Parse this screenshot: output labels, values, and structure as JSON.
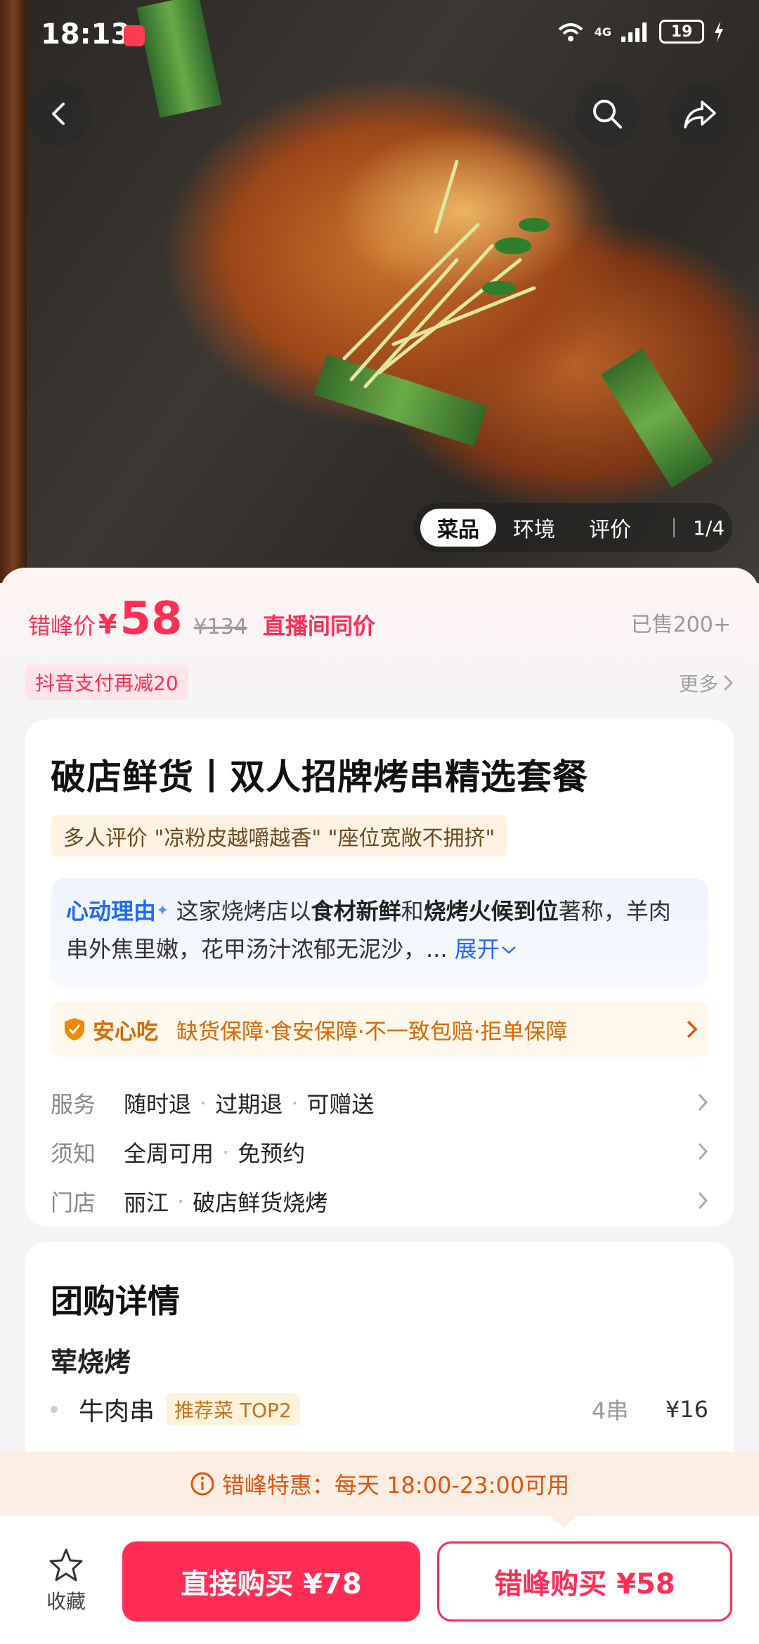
{
  "status_bar": {
    "time": "18:13",
    "network": "4G",
    "battery": "19"
  },
  "gallery": {
    "tabs": [
      "菜品",
      "环境",
      "评价"
    ],
    "active_tab": "菜品",
    "counter": "1/4"
  },
  "price": {
    "label": "错峰价",
    "currency": "¥",
    "value": "58",
    "original": "¥134",
    "live_note": "直播间同价",
    "sold": "已售200+"
  },
  "promo": {
    "coupon": "抖音支付再减20",
    "more": "更多"
  },
  "product": {
    "title": "破店鲜货丨双人招牌烤串精选套餐",
    "review_tag": "多人评价 \"凉粉皮越嚼越香\" \"座位宽敞不拥挤\""
  },
  "reason": {
    "title": "心动理由",
    "t1": " 这家烧烤店以",
    "b1": "食材新鲜",
    "t2": "和",
    "b2": "烧烤火候到位",
    "t3": "著称，羊肉串外焦里嫩，花甲汤汁浓郁无泥沙，...",
    "expand": "展开"
  },
  "safety": {
    "title": "安心吃",
    "items": "缺货保障·食安保障·不一致包赔·拒单保障"
  },
  "info": [
    {
      "key": "服务",
      "values": [
        "随时退",
        "过期退",
        "可赠送"
      ]
    },
    {
      "key": "须知",
      "values": [
        "全周可用",
        "免预约"
      ]
    },
    {
      "key": "门店",
      "values": [
        "丽江",
        "破店鲜货烧烤"
      ]
    }
  ],
  "detail": {
    "title": "团购详情",
    "group": "荤烧烤",
    "items": [
      {
        "name": "牛肉串",
        "tag": "推荐菜 TOP2",
        "qty": "4串",
        "price": "¥16"
      }
    ]
  },
  "offpeak": {
    "text": "错峰特惠：每天 18:00-23:00可用"
  },
  "bottom": {
    "fav": "收藏",
    "direct": "直接购买 ¥78",
    "peak": "错峰购买 ¥58"
  },
  "colors": {
    "accent": "#ff2d55",
    "blue": "#1f69ff",
    "orange": "#e0540f"
  }
}
